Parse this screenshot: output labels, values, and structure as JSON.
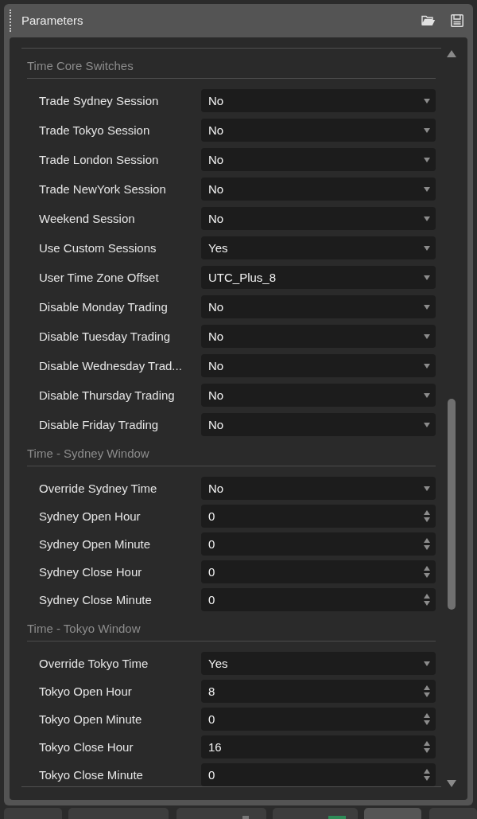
{
  "panel": {
    "title": "Parameters"
  },
  "sections": [
    {
      "title": "Time Core Switches",
      "params": [
        {
          "kind": "dropdown",
          "label": "Trade Sydney Session",
          "value": "No"
        },
        {
          "kind": "dropdown",
          "label": "Trade Tokyo Session",
          "value": "No"
        },
        {
          "kind": "dropdown",
          "label": "Trade London Session",
          "value": "No"
        },
        {
          "kind": "dropdown",
          "label": "Trade NewYork Session",
          "value": "No"
        },
        {
          "kind": "dropdown",
          "label": "Weekend Session",
          "value": "No"
        },
        {
          "kind": "dropdown",
          "label": "Use Custom Sessions",
          "value": "Yes"
        },
        {
          "kind": "dropdown",
          "label": "User Time Zone Offset",
          "value": "UTC_Plus_8"
        },
        {
          "kind": "dropdown",
          "label": "Disable Monday Trading",
          "value": "No"
        },
        {
          "kind": "dropdown",
          "label": "Disable Tuesday Trading",
          "value": "No"
        },
        {
          "kind": "dropdown",
          "label": "Disable Wednesday Trad...",
          "value": "No"
        },
        {
          "kind": "dropdown",
          "label": "Disable Thursday Trading",
          "value": "No"
        },
        {
          "kind": "dropdown",
          "label": "Disable Friday Trading",
          "value": "No"
        }
      ]
    },
    {
      "title": "Time - Sydney Window",
      "params": [
        {
          "kind": "dropdown",
          "label": "Override Sydney Time",
          "value": "No"
        },
        {
          "kind": "spinner",
          "label": "Sydney Open Hour",
          "value": "0"
        },
        {
          "kind": "spinner",
          "label": "Sydney Open Minute",
          "value": "0"
        },
        {
          "kind": "spinner",
          "label": "Sydney Close Hour",
          "value": "0"
        },
        {
          "kind": "spinner",
          "label": "Sydney Close Minute",
          "value": "0"
        }
      ]
    },
    {
      "title": "Time - Tokyo Window",
      "params": [
        {
          "kind": "dropdown",
          "label": "Override Tokyo Time",
          "value": "Yes"
        },
        {
          "kind": "spinner",
          "label": "Tokyo Open Hour",
          "value": "8"
        },
        {
          "kind": "spinner",
          "label": "Tokyo Open Minute",
          "value": "0"
        },
        {
          "kind": "spinner",
          "label": "Tokyo Close Hour",
          "value": "16"
        },
        {
          "kind": "spinner",
          "label": "Tokyo Close Minute",
          "value": "0"
        }
      ]
    }
  ],
  "bottom_tabs": [
    {
      "selected": false
    },
    {
      "selected": false
    },
    {
      "selected": false
    },
    {
      "selected": false
    },
    {
      "selected": true
    },
    {
      "selected": false
    }
  ]
}
